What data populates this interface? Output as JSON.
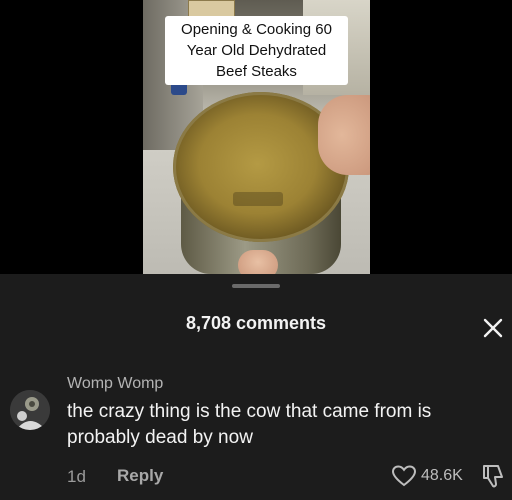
{
  "video": {
    "caption_lines": [
      "Opening & Cooking 60",
      "Year Old Dehydrated",
      "Beef Steaks"
    ]
  },
  "comments_panel": {
    "count_label": "8,708 comments",
    "close_icon": "close-icon"
  },
  "comment": {
    "username": "Womp Womp",
    "text_lines": [
      "the crazy thing is the cow that came from is",
      "probably dead by now"
    ],
    "time": "1d",
    "reply_label": "Reply",
    "like_count": "48.6K",
    "like_icon": "heart-icon",
    "dislike_icon": "thumbs-down-icon"
  },
  "colors": {
    "background": "#000000",
    "sheet": "#1c1c1c",
    "text": "#f3f3f3",
    "muted": "#9b9b9b"
  }
}
